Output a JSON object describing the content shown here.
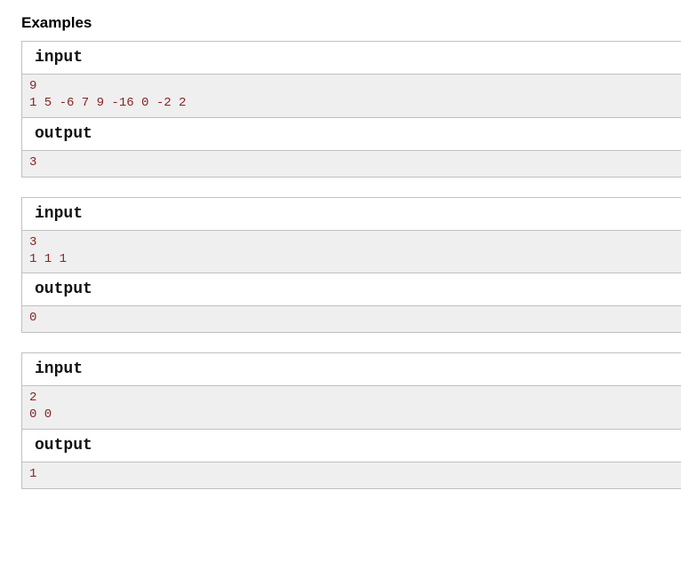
{
  "section_title": "Examples",
  "labels": {
    "input": "input",
    "output": "output"
  },
  "examples": [
    {
      "input": "9\n1 5 -6 7 9 -16 0 -2 2",
      "output": "3"
    },
    {
      "input": "3\n1 1 1",
      "output": "0"
    },
    {
      "input": "2\n0 0",
      "output": "1"
    }
  ]
}
